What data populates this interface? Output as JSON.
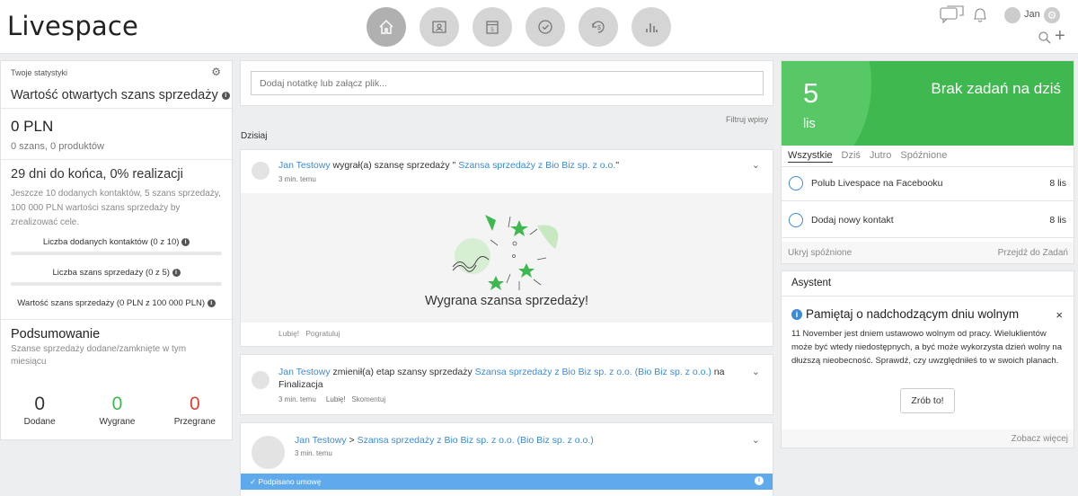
{
  "header": {
    "logo": "Livespace",
    "nav": [
      "home-icon",
      "contacts-icon",
      "calendar-icon",
      "tasks-icon",
      "deals-icon",
      "reports-icon"
    ],
    "user": "Jan"
  },
  "stats": {
    "heading": "Twoje statystyki",
    "title": "Wartość otwartych szans sprzedaży",
    "amount": "0 PLN",
    "amount_sub": "0 szans, 0 produktów",
    "period_title": "29 dni do końca, 0% realizacji",
    "period_desc": "Jeszcze 10 dodanych kontaktów, 5 szans sprzedaży, 100 000 PLN wartości szans sprzedaży by zrealizować cele.",
    "metrics": [
      {
        "label": "Liczba dodanych kontaktów (0 z 10)",
        "progress": 0
      },
      {
        "label": "Liczba szans sprzedaży (0 z 5)",
        "progress": 0
      },
      {
        "label": "Wartość szans sprzedaży (0 PLN z 100 000 PLN)",
        "progress": 0
      }
    ],
    "summary_title": "Podsumowanie",
    "summary_desc": "Szanse sprzedaży dodane/zamknięte w tym miesiącu",
    "counts": [
      {
        "value": "0",
        "label": "Dodane",
        "color": "#333333"
      },
      {
        "value": "0",
        "label": "Wygrane",
        "color": "#3fb84f"
      },
      {
        "value": "0",
        "label": "Przegrane",
        "color": "#d9433a"
      }
    ]
  },
  "feed": {
    "note_placeholder": "Dodaj notatkę lub załącz plik...",
    "filter": "Filtruj wpisy",
    "day": "Dzisiaj",
    "entry1": {
      "user": "Jan Testowy",
      "action": " wygrał(a) szansę sprzedaży \" ",
      "deal": "Szansa sprzedaży z Bio Biz sp. z o.o.",
      "end": "\"",
      "time": "3 min. temu",
      "banner": "Wygrana szansa sprzedaży!",
      "like": "Lubię!",
      "congrats": "Pogratuluj"
    },
    "entry2": {
      "user": "Jan Testowy",
      "action": " zmienił(a) etap szansy sprzedaży ",
      "deal": "Szansa sprzedaży z Bio Biz sp. z o.o. (Bio Biz sp. z o.o.)",
      "na": " na",
      "stage": "Finalizacja",
      "time": "3 min. temu",
      "like": "Lubię!",
      "comment": "Skomentuj"
    },
    "entry3": {
      "user": "Jan Testowy",
      "sep": " > ",
      "deal": "Szansa sprzedaży z Bio Biz sp. z o.o. (Bio Biz sp. z o.o.)",
      "time": "3 min. temu",
      "status": "✓ Podpisano umowę"
    }
  },
  "tasks": {
    "count": "5",
    "month": "lis",
    "empty": "Brak zadań na dziś",
    "tabs": [
      "Wszystkie",
      "Dziś",
      "Jutro",
      "Spóźnione"
    ],
    "items": [
      {
        "label": "Polub Livespace na Facebooku",
        "date": "8 lis"
      },
      {
        "label": "Dodaj nowy kontakt",
        "date": "8 lis"
      }
    ],
    "hide_late": "Ukryj spóźnione",
    "go_to": "Przejdź do Zadań"
  },
  "assistant": {
    "title": "Asystent",
    "heading": "Pamiętaj o nadchodzącym dniu wolnym",
    "text": "11 November jest dniem ustawowo wolnym od pracy. Wieluklientów może być wtedy niedostępnych, a być może wykorzysta dzień wolny na dłuższą nieobecność. Sprawdź, czy uwzględniłeś to w swoich planach.",
    "button": "Zrób to!",
    "more": "Zobacz więcej"
  },
  "colors": {
    "green": "#3fb84f",
    "blue": "#3a8bd6",
    "red": "#d9433a"
  }
}
